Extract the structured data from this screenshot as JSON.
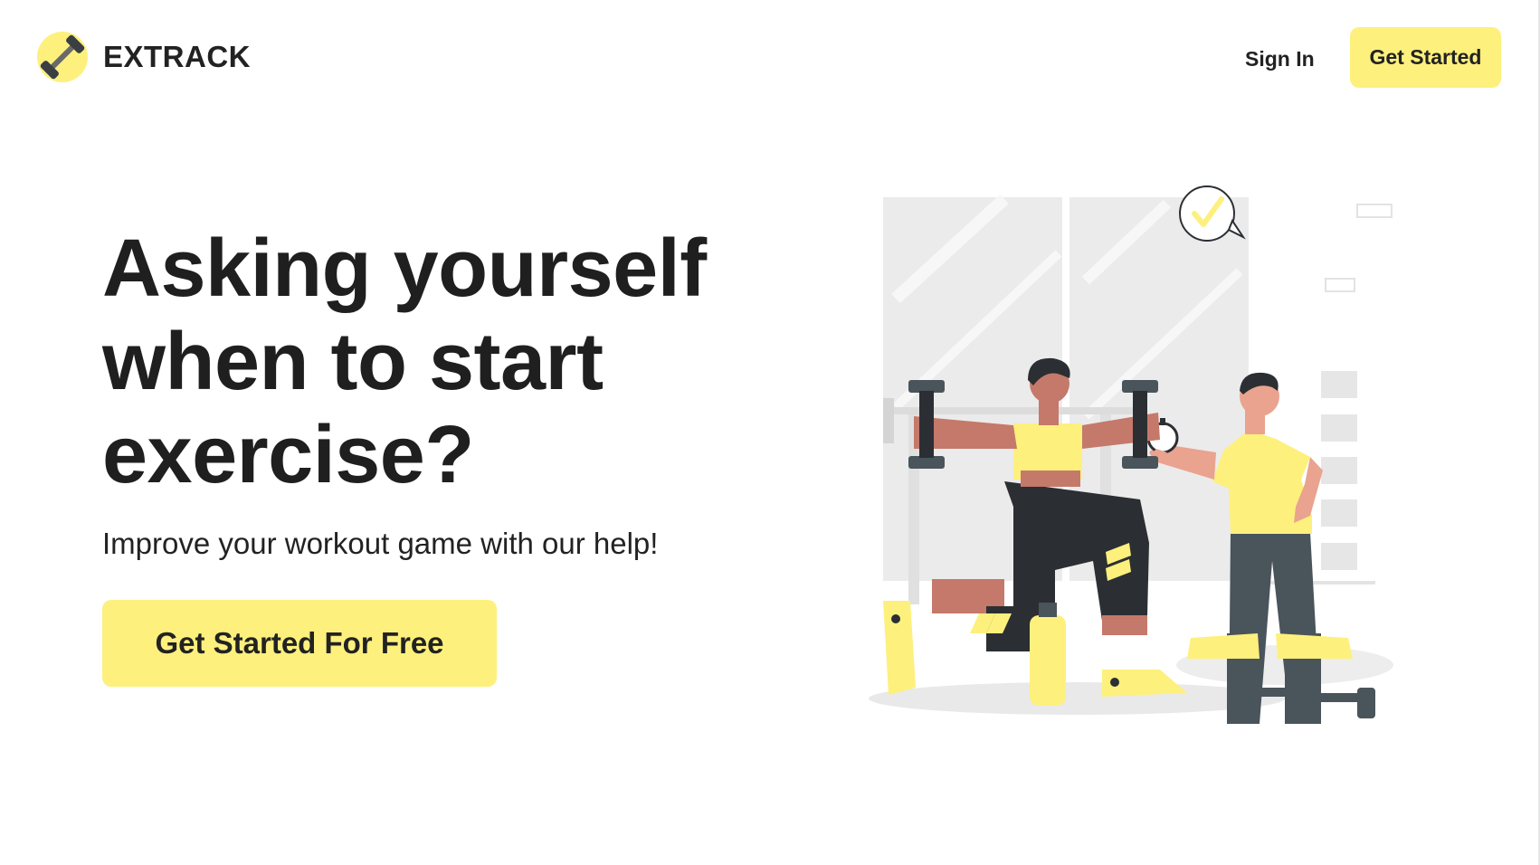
{
  "brand": {
    "name": "EXTRACK",
    "accent": "#fdf07d"
  },
  "nav": {
    "sign_in": "Sign In",
    "get_started": "Get Started"
  },
  "hero": {
    "title_line1": "Asking yourself",
    "title_line2": "when to start",
    "title_line3": "exercise?",
    "subtitle": "Improve your workout game with our help!",
    "cta": "Get Started For Free"
  },
  "colors": {
    "skin": "#c5796a",
    "dark": "#2b2f33",
    "slate": "#4a545b",
    "yellow": "#fdf07d",
    "floor": "#e9e9e9"
  }
}
